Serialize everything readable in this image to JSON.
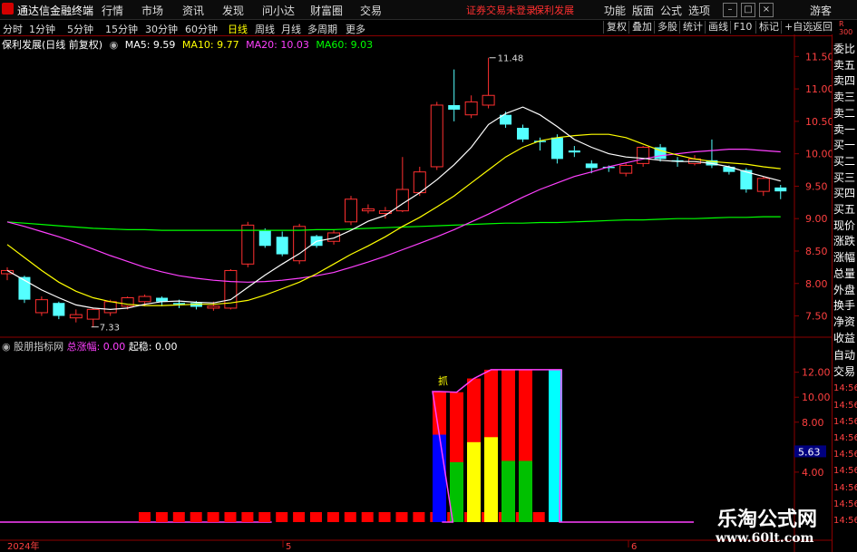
{
  "menubar": {
    "app_title": "通达信金融终端",
    "items": [
      "行情",
      "市场",
      "资讯",
      "发现",
      "问小达",
      "财富圈",
      "交易"
    ],
    "notice": "证券交易未登录",
    "stock_name": "保利发展",
    "right_items": [
      "功能",
      "版面",
      "公式",
      "选项"
    ],
    "guest": "游客"
  },
  "periodbar": {
    "periods": [
      "分时",
      "1分钟",
      "5分钟",
      "15分钟",
      "30分钟",
      "60分钟",
      "日线",
      "周线",
      "月线",
      "多周期",
      "更多"
    ],
    "active": "日线",
    "tools": [
      "复权",
      "叠加",
      "多股",
      "统计",
      "画线",
      "F10",
      "标记",
      "+自选",
      "返回"
    ],
    "zoom": "R 300"
  },
  "main_legend": {
    "title": "保利发展(日线 前复权)",
    "ma5": "MA5: 9.59",
    "ma10": "MA10: 9.77",
    "ma20": "MA20: 10.03",
    "ma60": "MA60: 9.03",
    "colors": {
      "ma5": "#ffffff",
      "ma10": "#ffff00",
      "ma20": "#ff40ff",
      "ma60": "#00ff00"
    }
  },
  "sub_legend": {
    "title": "股朋指标网",
    "total_label": "总涨幅: 0.00",
    "stable_label": "起稳: 0.00",
    "marker": "抓"
  },
  "price_axis": {
    "ticks": [
      "11.50",
      "11.00",
      "10.50",
      "10.00",
      "9.50",
      "9.00",
      "8.50",
      "8.00",
      "7.50"
    ],
    "max_label": "11.48",
    "min_label": "7.33"
  },
  "sub_axis": {
    "ticks": [
      "12.00",
      "10.00",
      "8.00",
      "4.00"
    ],
    "highlight": "5.63"
  },
  "date_axis": {
    "labels": [
      "2024年",
      "5",
      "6"
    ]
  },
  "side_panel": {
    "items": [
      "委比",
      "卖五",
      "卖四",
      "卖三",
      "卖二",
      "卖一",
      "买一",
      "买二",
      "买三",
      "买四",
      "买五",
      "现价",
      "涨跌",
      "涨幅",
      "总量",
      "外盘",
      "换手",
      "净资",
      "收益"
    ],
    "bottom": [
      "自动",
      "交易",
      "14:56",
      "14:56",
      "14:56",
      "14:56",
      "14:56",
      "14:56",
      "14:56",
      "14:56",
      "14:56"
    ]
  },
  "watermark": {
    "line1": "乐淘公式网",
    "line2": "www.60lt.com"
  },
  "chart_data": {
    "type": "candlestick",
    "title": "保利发展(日线 前复权)",
    "ylim": [
      7.2,
      11.7
    ],
    "candles": [
      {
        "o": 8.15,
        "c": 8.2,
        "h": 8.25,
        "l": 8.05
      },
      {
        "o": 8.1,
        "c": 7.75,
        "h": 8.12,
        "l": 7.7
      },
      {
        "o": 7.55,
        "c": 7.75,
        "h": 7.8,
        "l": 7.5
      },
      {
        "o": 7.7,
        "c": 7.5,
        "h": 7.72,
        "l": 7.45
      },
      {
        "o": 7.47,
        "c": 7.52,
        "h": 7.6,
        "l": 7.4
      },
      {
        "o": 7.45,
        "c": 7.6,
        "h": 7.62,
        "l": 7.33
      },
      {
        "o": 7.55,
        "c": 7.72,
        "h": 7.75,
        "l": 7.5
      },
      {
        "o": 7.65,
        "c": 7.78,
        "h": 7.8,
        "l": 7.6
      },
      {
        "o": 7.72,
        "c": 7.8,
        "h": 7.83,
        "l": 7.65
      },
      {
        "o": 7.78,
        "c": 7.72,
        "h": 7.8,
        "l": 7.65
      },
      {
        "o": 7.7,
        "c": 7.68,
        "h": 7.75,
        "l": 7.62
      },
      {
        "o": 7.7,
        "c": 7.64,
        "h": 7.73,
        "l": 7.6
      },
      {
        "o": 7.62,
        "c": 7.65,
        "h": 7.72,
        "l": 7.58
      },
      {
        "o": 7.62,
        "c": 8.2,
        "h": 8.22,
        "l": 7.6
      },
      {
        "o": 8.3,
        "c": 8.9,
        "h": 8.95,
        "l": 8.25
      },
      {
        "o": 8.82,
        "c": 8.58,
        "h": 8.85,
        "l": 8.55
      },
      {
        "o": 8.72,
        "c": 8.45,
        "h": 8.8,
        "l": 8.42
      },
      {
        "o": 8.35,
        "c": 8.88,
        "h": 8.92,
        "l": 8.3
      },
      {
        "o": 8.73,
        "c": 8.58,
        "h": 8.75,
        "l": 8.55
      },
      {
        "o": 8.65,
        "c": 8.78,
        "h": 8.82,
        "l": 8.6
      },
      {
        "o": 8.95,
        "c": 9.3,
        "h": 9.35,
        "l": 8.9
      },
      {
        "o": 9.12,
        "c": 9.15,
        "h": 9.22,
        "l": 9.08
      },
      {
        "o": 9.08,
        "c": 9.12,
        "h": 9.18,
        "l": 9.0
      },
      {
        "o": 9.12,
        "c": 9.45,
        "h": 9.95,
        "l": 9.1
      },
      {
        "o": 9.4,
        "c": 9.72,
        "h": 9.8,
        "l": 9.35
      },
      {
        "o": 9.8,
        "c": 10.75,
        "h": 10.8,
        "l": 9.75
      },
      {
        "o": 10.75,
        "c": 10.68,
        "h": 11.3,
        "l": 10.5
      },
      {
        "o": 10.6,
        "c": 10.8,
        "h": 10.9,
        "l": 10.55
      },
      {
        "o": 10.75,
        "c": 10.9,
        "h": 11.48,
        "l": 10.7
      },
      {
        "o": 10.6,
        "c": 10.45,
        "h": 10.65,
        "l": 10.4
      },
      {
        "o": 10.4,
        "c": 10.22,
        "h": 10.45,
        "l": 10.18
      },
      {
        "o": 10.2,
        "c": 10.18,
        "h": 10.25,
        "l": 10.05
      },
      {
        "o": 10.25,
        "c": 9.92,
        "h": 10.3,
        "l": 9.85
      },
      {
        "o": 10.05,
        "c": 10.02,
        "h": 10.12,
        "l": 9.95
      },
      {
        "o": 9.85,
        "c": 9.78,
        "h": 9.9,
        "l": 9.7
      },
      {
        "o": 9.8,
        "c": 9.78,
        "h": 9.82,
        "l": 9.72
      },
      {
        "o": 9.7,
        "c": 9.82,
        "h": 9.85,
        "l": 9.65
      },
      {
        "o": 9.85,
        "c": 10.1,
        "h": 10.12,
        "l": 9.8
      },
      {
        "o": 10.1,
        "c": 9.92,
        "h": 10.15,
        "l": 9.88
      },
      {
        "o": 9.9,
        "c": 9.88,
        "h": 9.95,
        "l": 9.8
      },
      {
        "o": 9.85,
        "c": 9.92,
        "h": 9.98,
        "l": 9.82
      },
      {
        "o": 9.9,
        "c": 9.82,
        "h": 10.22,
        "l": 9.78
      },
      {
        "o": 9.8,
        "c": 9.72,
        "h": 9.82,
        "l": 9.68
      },
      {
        "o": 9.75,
        "c": 9.45,
        "h": 9.78,
        "l": 9.4
      },
      {
        "o": 9.42,
        "c": 9.62,
        "h": 9.65,
        "l": 9.35
      },
      {
        "o": 9.48,
        "c": 9.42,
        "h": 9.52,
        "l": 9.3
      }
    ],
    "ma5": [
      8.2,
      8.05,
      7.9,
      7.78,
      7.67,
      7.62,
      7.6,
      7.62,
      7.68,
      7.72,
      7.73,
      7.71,
      7.7,
      7.75,
      7.94,
      8.13,
      8.3,
      8.46,
      8.65,
      8.7,
      8.82,
      8.96,
      9.05,
      9.23,
      9.4,
      9.6,
      9.83,
      10.1,
      10.45,
      10.62,
      10.72,
      10.6,
      10.42,
      10.22,
      10.1,
      10.0,
      9.95,
      9.93,
      9.9,
      9.88,
      9.88,
      9.85,
      9.8,
      9.72,
      9.65,
      9.58
    ],
    "ma10": [
      8.6,
      8.4,
      8.2,
      8.02,
      7.88,
      7.78,
      7.72,
      7.68,
      7.66,
      7.66,
      7.67,
      7.68,
      7.68,
      7.7,
      7.74,
      7.82,
      7.92,
      8.02,
      8.15,
      8.3,
      8.45,
      8.58,
      8.72,
      8.88,
      9.02,
      9.18,
      9.35,
      9.55,
      9.75,
      9.95,
      10.1,
      10.2,
      10.25,
      10.28,
      10.3,
      10.3,
      10.25,
      10.15,
      10.05,
      9.98,
      9.92,
      9.88,
      9.86,
      9.84,
      9.8,
      9.77
    ],
    "ma20": [
      8.95,
      8.88,
      8.8,
      8.72,
      8.63,
      8.53,
      8.43,
      8.34,
      8.25,
      8.18,
      8.12,
      8.08,
      8.05,
      8.03,
      8.02,
      8.03,
      8.05,
      8.08,
      8.12,
      8.17,
      8.25,
      8.33,
      8.42,
      8.52,
      8.62,
      8.72,
      8.83,
      8.95,
      9.07,
      9.2,
      9.33,
      9.45,
      9.55,
      9.65,
      9.72,
      9.8,
      9.86,
      9.92,
      9.97,
      10.0,
      10.03,
      10.05,
      10.07,
      10.07,
      10.05,
      10.03
    ],
    "ma60": [
      8.95,
      8.93,
      8.91,
      8.89,
      8.87,
      8.85,
      8.84,
      8.83,
      8.83,
      8.82,
      8.82,
      8.82,
      8.82,
      8.82,
      8.82,
      8.82,
      8.82,
      8.82,
      8.83,
      8.83,
      8.84,
      8.85,
      8.86,
      8.87,
      8.88,
      8.89,
      8.9,
      8.91,
      8.92,
      8.93,
      8.93,
      8.94,
      8.94,
      8.95,
      8.96,
      8.97,
      8.98,
      8.98,
      8.99,
      9.0,
      9.0,
      9.01,
      9.02,
      9.02,
      9.03,
      9.03
    ],
    "sub_ylim": [
      0,
      13.5
    ],
    "sub_bars": [
      {
        "top": 0,
        "fill": 0,
        "color": "#ff0000"
      },
      {
        "top": 0,
        "fill": 0,
        "color": "#ff0000"
      },
      {
        "top": 0,
        "fill": 0,
        "color": "#ff0000"
      },
      {
        "top": 0,
        "fill": 0,
        "color": "#ff0000"
      },
      {
        "top": 0,
        "fill": 0,
        "color": "#ff0000"
      },
      {
        "top": 0,
        "fill": 0,
        "color": "#ff0000"
      },
      {
        "top": 0,
        "fill": 0,
        "color": "#ff0000"
      },
      {
        "top": 0,
        "fill": 0,
        "color": "#ff0000"
      },
      {
        "top": 0,
        "fill": 0,
        "color": "#ff0000"
      },
      {
        "top": 0,
        "fill": 0,
        "color": "#ff0000"
      },
      {
        "top": 0,
        "fill": 0,
        "color": "#ff0000"
      },
      {
        "top": 0,
        "fill": 0,
        "color": "#ff0000"
      },
      {
        "top": 0,
        "fill": 0,
        "color": "#ff0000"
      },
      {
        "top": 0,
        "fill": 0,
        "color": "#ff0000"
      },
      {
        "top": 0,
        "fill": 0,
        "color": "#ff0000"
      },
      {
        "top": 0,
        "fill": 0,
        "color": "#ff0000"
      },
      {
        "top": 0,
        "fill": 0,
        "color": "#ff0000"
      },
      {
        "top": 0,
        "fill": 0,
        "color": "#ff0000"
      },
      {
        "top": 0,
        "fill": 0,
        "color": "#ff0000"
      },
      {
        "top": 0,
        "fill": 0,
        "color": "#ff0000"
      },
      {
        "top": 0,
        "fill": 0,
        "color": "#ff0000"
      },
      {
        "top": 0,
        "fill": 0,
        "color": "#ff0000"
      },
      {
        "top": 0,
        "fill": 0,
        "color": "#ff0000"
      },
      {
        "top": 0,
        "fill": 0,
        "color": "#ff0000"
      },
      {
        "top": 0,
        "fill": 0,
        "color": "#ff0000"
      },
      {
        "top": 10.45,
        "fill": 7.0,
        "color": "#0000ff"
      },
      {
        "top": 10.4,
        "fill": 4.8,
        "color": "#00c000"
      },
      {
        "top": 11.5,
        "fill": 6.4,
        "color": "#ffff00"
      },
      {
        "top": 12.2,
        "fill": 6.8,
        "color": "#ffff00"
      },
      {
        "top": 12.2,
        "fill": 4.9,
        "color": "#00c000"
      },
      {
        "top": 12.2,
        "fill": 4.9,
        "color": "#00c000"
      },
      {
        "top": 12.2,
        "fill": 12.2,
        "color": "#00ffff"
      }
    ]
  }
}
